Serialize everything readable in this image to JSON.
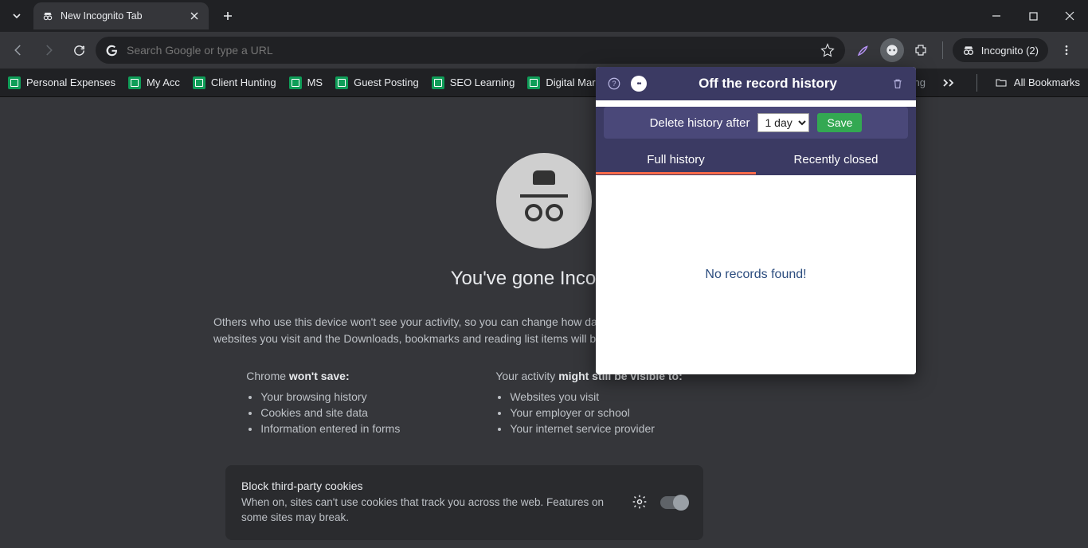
{
  "tab": {
    "title": "New Incognito Tab"
  },
  "omnibox": {
    "placeholder": "Search Google or type a URL"
  },
  "incognito_chip": "Incognito (2)",
  "bookmarks": [
    "Personal Expenses",
    "My  Acc",
    "Client Hunting",
    "MS",
    "Guest Posting",
    "SEO Learning",
    "Digital Marketing"
  ],
  "bookmarks_overflow_hint": "ning",
  "all_bookmarks": "All Bookmarks",
  "page": {
    "headline": "You've gone Incognito",
    "para": "Others who use this device won't see your activity, so you can  change how data is collected by websites you visit and the  Downloads, bookmarks and reading list items will be saved.",
    "wont_save_label_pre": "Chrome ",
    "wont_save_label_strong": "won't save:",
    "wont_save": [
      "Your browsing history",
      "Cookies and site data",
      "Information entered in forms"
    ],
    "visible_label_pre": "Your activity ",
    "visible_label_strong": "might still be visible to:",
    "visible": [
      "Websites you visit",
      "Your employer or school",
      "Your internet service provider"
    ],
    "cookie_title": "Block third-party cookies",
    "cookie_sub": "When on, sites can't use cookies that track you across the web. Features on some sites may break."
  },
  "popup": {
    "title": "Off the record history",
    "delete_label": "Delete history after",
    "delete_option": "1 day",
    "save": "Save",
    "tab_full": "Full history",
    "tab_recent": "Recently closed",
    "empty": "No records found!"
  }
}
